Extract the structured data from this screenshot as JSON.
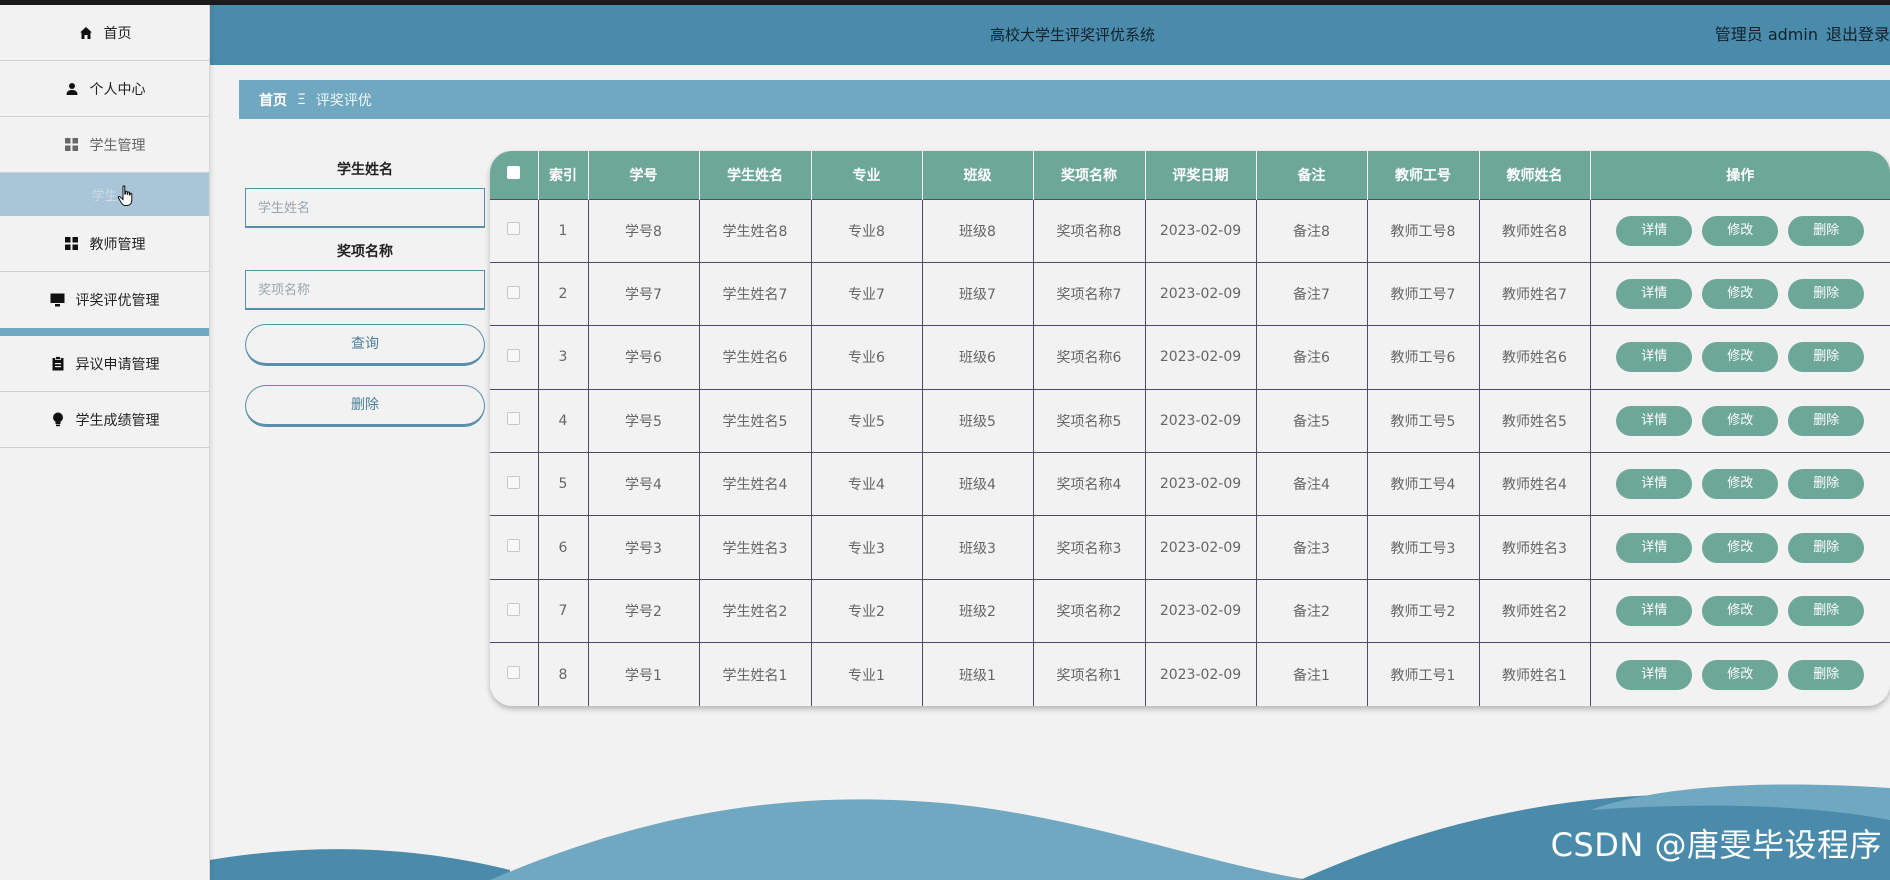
{
  "header": {
    "title": "高校大学生评奖评优系统",
    "user_label": "管理员 admin",
    "logout_label": "退出登录"
  },
  "sidebar": {
    "items": [
      {
        "label": "首页",
        "icon": "home-icon"
      },
      {
        "label": "个人中心",
        "icon": "user-icon"
      },
      {
        "label": "学生管理",
        "icon": "grid-icon"
      },
      {
        "label": "学生",
        "icon": ""
      },
      {
        "label": "教师管理",
        "icon": "grid-icon"
      },
      {
        "label": "评奖评优管理",
        "icon": "monitor-icon"
      },
      {
        "label": "异议申请管理",
        "icon": "clipboard-icon"
      },
      {
        "label": "学生成绩管理",
        "icon": "bulb-icon"
      }
    ]
  },
  "breadcrumb": {
    "home": "首页",
    "separator": "Ξ",
    "current": "评奖评优"
  },
  "search": {
    "name_label": "学生姓名",
    "name_placeholder": "学生姓名",
    "award_label": "奖项名称",
    "award_placeholder": "奖项名称",
    "query_button": "查询",
    "delete_button": "删除"
  },
  "table": {
    "columns": [
      "索引",
      "学号",
      "学生姓名",
      "专业",
      "班级",
      "奖项名称",
      "评奖日期",
      "备注",
      "教师工号",
      "教师姓名",
      "操作"
    ],
    "actions": {
      "detail": "详情",
      "edit": "修改",
      "delete": "删除"
    },
    "rows": [
      {
        "index": "1",
        "student_no": "学号8",
        "student_name": "学生姓名8",
        "major": "专业8",
        "class": "班级8",
        "award": "奖项名称8",
        "date": "2023-02-09",
        "note": "备注8",
        "teacher_no": "教师工号8",
        "teacher_name": "教师姓名8"
      },
      {
        "index": "2",
        "student_no": "学号7",
        "student_name": "学生姓名7",
        "major": "专业7",
        "class": "班级7",
        "award": "奖项名称7",
        "date": "2023-02-09",
        "note": "备注7",
        "teacher_no": "教师工号7",
        "teacher_name": "教师姓名7"
      },
      {
        "index": "3",
        "student_no": "学号6",
        "student_name": "学生姓名6",
        "major": "专业6",
        "class": "班级6",
        "award": "奖项名称6",
        "date": "2023-02-09",
        "note": "备注6",
        "teacher_no": "教师工号6",
        "teacher_name": "教师姓名6"
      },
      {
        "index": "4",
        "student_no": "学号5",
        "student_name": "学生姓名5",
        "major": "专业5",
        "class": "班级5",
        "award": "奖项名称5",
        "date": "2023-02-09",
        "note": "备注5",
        "teacher_no": "教师工号5",
        "teacher_name": "教师姓名5"
      },
      {
        "index": "5",
        "student_no": "学号4",
        "student_name": "学生姓名4",
        "major": "专业4",
        "class": "班级4",
        "award": "奖项名称4",
        "date": "2023-02-09",
        "note": "备注4",
        "teacher_no": "教师工号4",
        "teacher_name": "教师姓名4"
      },
      {
        "index": "6",
        "student_no": "学号3",
        "student_name": "学生姓名3",
        "major": "专业3",
        "class": "班级3",
        "award": "奖项名称3",
        "date": "2023-02-09",
        "note": "备注3",
        "teacher_no": "教师工号3",
        "teacher_name": "教师姓名3"
      },
      {
        "index": "7",
        "student_no": "学号2",
        "student_name": "学生姓名2",
        "major": "专业2",
        "class": "班级2",
        "award": "奖项名称2",
        "date": "2023-02-09",
        "note": "备注2",
        "teacher_no": "教师工号2",
        "teacher_name": "教师姓名2"
      },
      {
        "index": "8",
        "student_no": "学号1",
        "student_name": "学生姓名1",
        "major": "专业1",
        "class": "班级1",
        "award": "奖项名称1",
        "date": "2023-02-09",
        "note": "备注1",
        "teacher_no": "教师工号1",
        "teacher_name": "教师姓名1"
      }
    ]
  },
  "watermark": "CSDN @唐雯毕设程序",
  "colors": {
    "header": "#4a8bab",
    "breadcrumb": "#6fa8c0",
    "table_header": "#6da798",
    "action_button": "#6da798",
    "background": "#f2f2f2"
  }
}
